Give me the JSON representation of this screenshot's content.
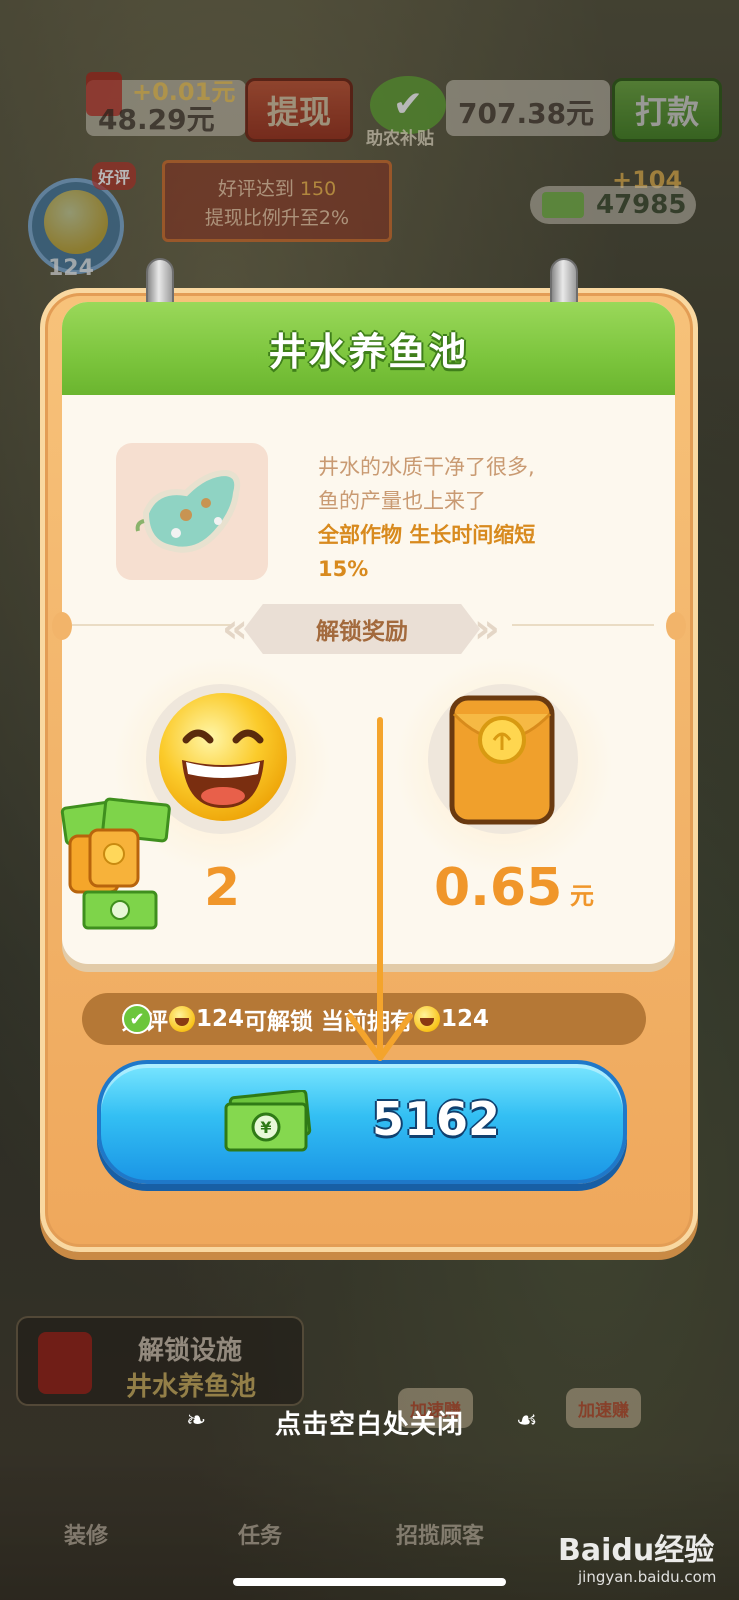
{
  "top_hud": {
    "cash_delta": "+0.01元",
    "cash_balance": "48.29元",
    "withdraw_button": "提现",
    "subsidy_label": "助农补贴",
    "subsidy_amount": "707.38元",
    "payout_button": "打款",
    "rating_tag": "好评",
    "rating_count": "124",
    "withdraw_hint_line1_prefix": "好评达到",
    "withdraw_hint_target": "150",
    "withdraw_hint_line2": "提现比例升至2%",
    "money_delta": "+104",
    "money_total": "47985"
  },
  "dialog": {
    "title": "井水养鱼池",
    "description_line1": "井水的水质干净了很多,",
    "description_line2": "鱼的产量也上来了",
    "effect_line": "全部作物 生长时间缩短",
    "effect_value": "15%",
    "rewards_banner": "解锁奖励",
    "rewards": [
      {
        "icon": "smile-emoji-icon",
        "value": "2",
        "unit": ""
      },
      {
        "icon": "red-envelope-icon",
        "value": "0.65",
        "unit": "元"
      }
    ],
    "requirement": {
      "label": "好评",
      "required": "124",
      "middle": "可解锁 当前拥有",
      "owned": "124"
    },
    "cost_button_value": "5162"
  },
  "close_hint": "点击空白处关闭",
  "background_ui": {
    "unlock_card_line1": "解锁设施",
    "unlock_card_line2": "井水养鱼池",
    "speedup_left": "加速赚",
    "speedup_right": "加速赚",
    "nav_items": [
      "装修",
      "任务",
      "招揽顾客"
    ]
  },
  "watermark": {
    "brand": "Baidu经验",
    "url": "jingyan.baidu.com"
  },
  "colors": {
    "header_green": "#7cc53d",
    "frame_orange": "#f2b46a",
    "button_blue": "#33bff3",
    "value_orange": "#f0962a"
  }
}
